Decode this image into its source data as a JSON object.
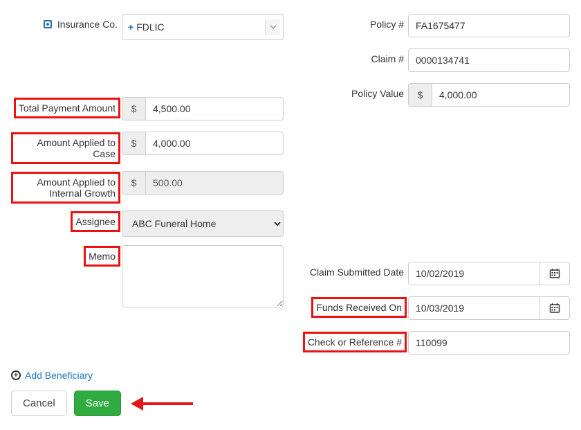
{
  "left": {
    "labels": {
      "insurance_co": "Insurance Co.",
      "total_payment_amount": "Total Payment Amount",
      "amount_applied_case": "Amount Applied to Case",
      "amount_applied_growth": "Amount Applied to Internal Growth",
      "assignee": "Assignee",
      "memo": "Memo"
    },
    "values": {
      "insurance_co": "FDLIC",
      "total_payment_amount": "4,500.00",
      "amount_applied_case": "4,000.00",
      "amount_applied_growth": "500.00",
      "assignee": "ABC Funeral Home",
      "memo": ""
    },
    "currency_symbol": "$"
  },
  "right": {
    "labels": {
      "policy_no": "Policy #",
      "claim_no": "Claim #",
      "policy_value": "Policy Value",
      "claim_submitted_date": "Claim Submitted Date",
      "funds_received_on": "Funds Received On",
      "check_reference_no": "Check or Reference #"
    },
    "values": {
      "policy_no": "FA1675477",
      "claim_no": "0000134741",
      "policy_value": "4,000.00",
      "claim_submitted_date": "10/02/2019",
      "funds_received_on": "10/03/2019",
      "check_reference_no": "110099"
    },
    "currency_symbol": "$"
  },
  "footer": {
    "add_beneficiary": "Add Beneficiary",
    "cancel": "Cancel",
    "save": "Save"
  }
}
